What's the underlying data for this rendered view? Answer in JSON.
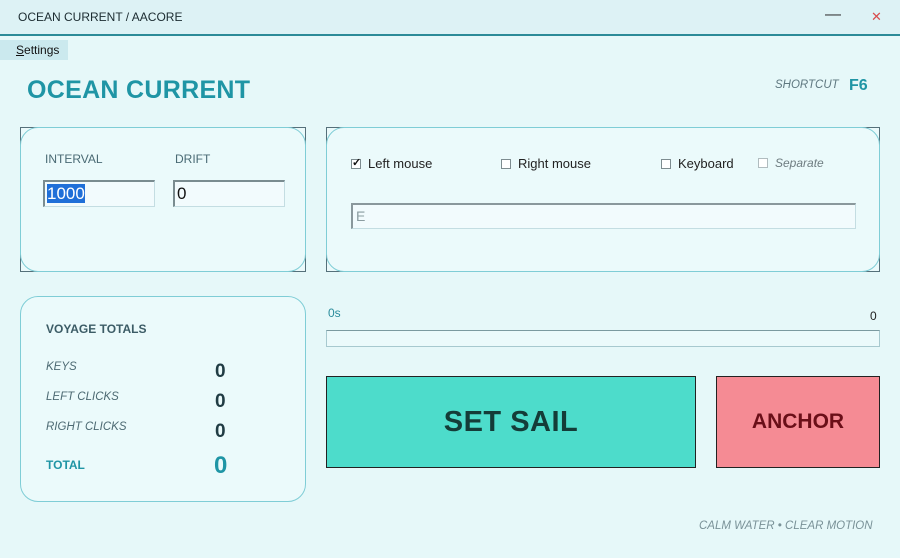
{
  "window": {
    "title": "OCEAN CURRENT  /  AACORE",
    "minimize_glyph": "—",
    "close_glyph": "✕"
  },
  "menu": {
    "settings_first": "S",
    "settings_rest": "ettings"
  },
  "header": {
    "app_title": "OCEAN CURRENT",
    "shortcut_label": "SHORTCUT",
    "shortcut_key": "F6"
  },
  "timing": {
    "interval_label": "INTERVAL",
    "interval_value": "1000",
    "drift_label": "DRIFT",
    "drift_value": "0"
  },
  "inputs": {
    "left_mouse": {
      "label": "Left mouse",
      "checked": true
    },
    "right_mouse": {
      "label": "Right mouse",
      "checked": false
    },
    "keyboard": {
      "label": "Keyboard",
      "checked": false
    },
    "separate": {
      "label": "Separate",
      "checked": false,
      "disabled": true
    },
    "key_value": "E"
  },
  "totals": {
    "heading": "VOYAGE TOTALS",
    "keys_label": "KEYS",
    "keys_value": "0",
    "left_clicks_label": "LEFT CLICKS",
    "left_clicks_value": "0",
    "right_clicks_label": "RIGHT CLICKS",
    "right_clicks_value": "0",
    "total_label": "TOTAL",
    "total_value": "0"
  },
  "progress": {
    "elapsed": "0s",
    "count": "0",
    "fraction": 0
  },
  "actions": {
    "start_label": "SET SAIL",
    "stop_label": "ANCHOR"
  },
  "footer": {
    "tagline": "CALM WATER • CLEAR MOTION"
  },
  "colors": {
    "accent": "#1f95a5",
    "start_button": "#4ddccb",
    "stop_button": "#f58b94",
    "background": "#e6f8f9"
  }
}
